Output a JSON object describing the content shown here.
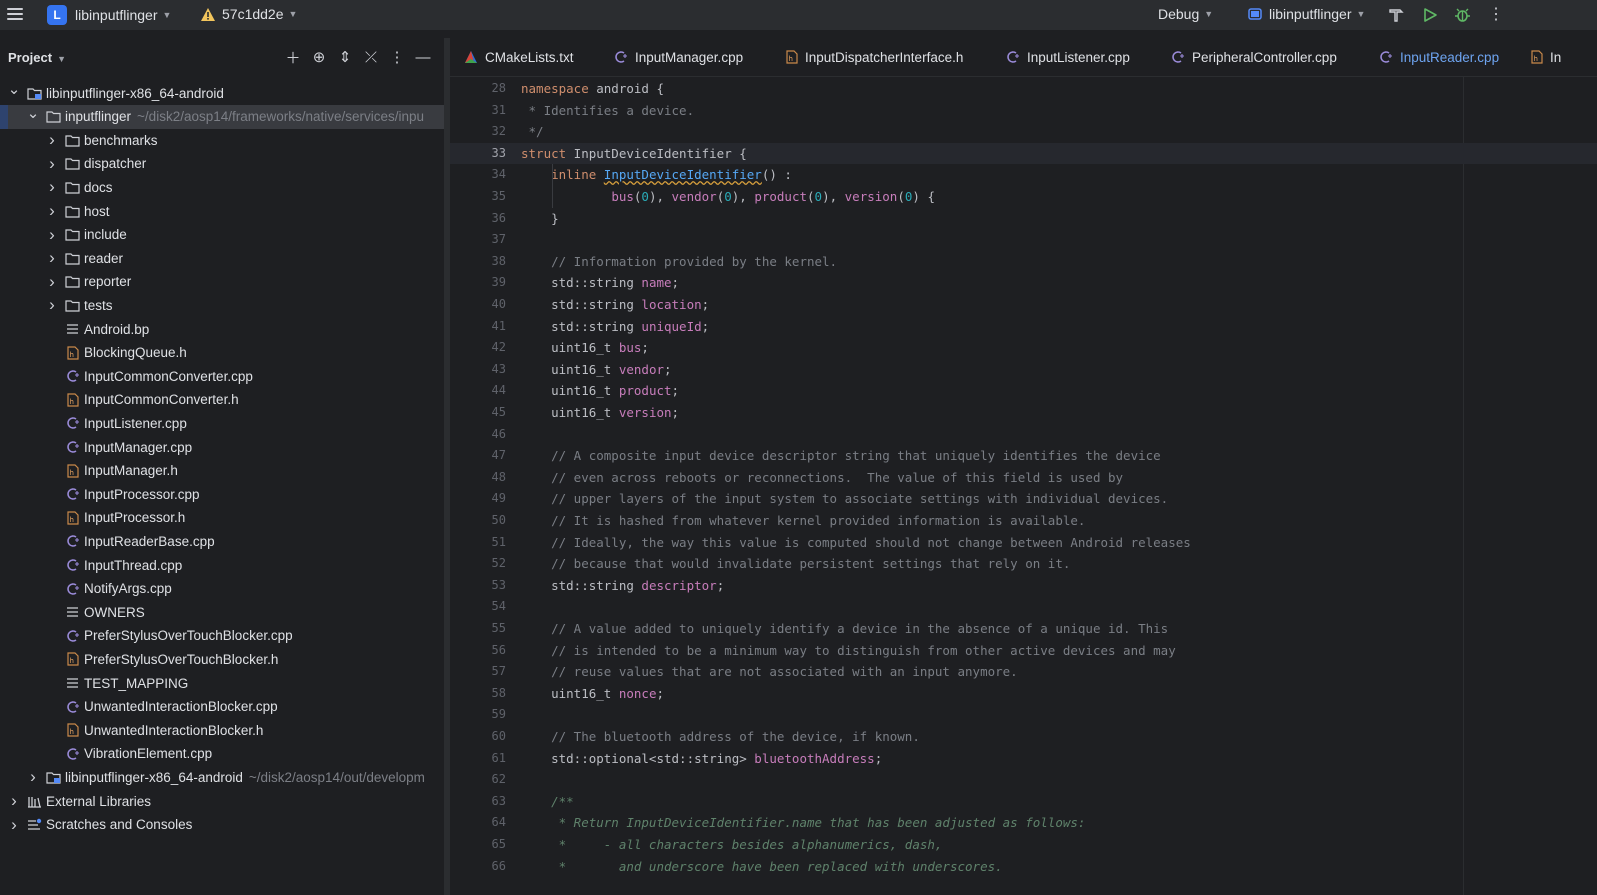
{
  "titlebar": {
    "project_initial": "L",
    "project_name": "libinputflinger",
    "vcs_branch": "57c1dd2e",
    "run_config": "Debug",
    "target": "libinputflinger",
    "icons": [
      "hamburger-menu-icon",
      "warning-icon",
      "build-hammer-icon",
      "run-icon",
      "debug-icon",
      "more-vertical-icon"
    ]
  },
  "project_pane": {
    "title": "Project",
    "rows": [
      {
        "label": "libinputflinger-x86_64-android",
        "path": "",
        "icon": "module-icon",
        "arrow": "down",
        "depth": 0
      },
      {
        "label": "inputflinger",
        "path": "~/disk2/aosp14/frameworks/native/services/inpu",
        "icon": "folder-icon",
        "arrow": "down",
        "depth": 1,
        "selected": true
      },
      {
        "label": "benchmarks",
        "path": "",
        "icon": "folder-icon",
        "arrow": "right",
        "depth": 2
      },
      {
        "label": "dispatcher",
        "path": "",
        "icon": "folder-icon",
        "arrow": "right",
        "depth": 2
      },
      {
        "label": "docs",
        "path": "",
        "icon": "folder-icon",
        "arrow": "right",
        "depth": 2
      },
      {
        "label": "host",
        "path": "",
        "icon": "folder-icon",
        "arrow": "right",
        "depth": 2
      },
      {
        "label": "include",
        "path": "",
        "icon": "folder-icon",
        "arrow": "right",
        "depth": 2
      },
      {
        "label": "reader",
        "path": "",
        "icon": "folder-icon",
        "arrow": "right",
        "depth": 2
      },
      {
        "label": "reporter",
        "path": "",
        "icon": "folder-icon",
        "arrow": "right",
        "depth": 2
      },
      {
        "label": "tests",
        "path": "",
        "icon": "folder-icon",
        "arrow": "right",
        "depth": 2
      },
      {
        "label": "Android.bp",
        "path": "",
        "icon": "text-file-icon",
        "arrow": "",
        "depth": 2
      },
      {
        "label": "BlockingQueue.h",
        "path": "",
        "icon": "header-file-icon",
        "arrow": "",
        "depth": 2
      },
      {
        "label": "InputCommonConverter.cpp",
        "path": "",
        "icon": "cpp-file-icon",
        "arrow": "",
        "depth": 2
      },
      {
        "label": "InputCommonConverter.h",
        "path": "",
        "icon": "header-file-icon",
        "arrow": "",
        "depth": 2
      },
      {
        "label": "InputListener.cpp",
        "path": "",
        "icon": "cpp-file-icon",
        "arrow": "",
        "depth": 2
      },
      {
        "label": "InputManager.cpp",
        "path": "",
        "icon": "cpp-file-icon",
        "arrow": "",
        "depth": 2
      },
      {
        "label": "InputManager.h",
        "path": "",
        "icon": "header-file-icon",
        "arrow": "",
        "depth": 2
      },
      {
        "label": "InputProcessor.cpp",
        "path": "",
        "icon": "cpp-file-icon",
        "arrow": "",
        "depth": 2
      },
      {
        "label": "InputProcessor.h",
        "path": "",
        "icon": "header-file-icon",
        "arrow": "",
        "depth": 2
      },
      {
        "label": "InputReaderBase.cpp",
        "path": "",
        "icon": "cpp-file-icon",
        "arrow": "",
        "depth": 2
      },
      {
        "label": "InputThread.cpp",
        "path": "",
        "icon": "cpp-file-icon",
        "arrow": "",
        "depth": 2
      },
      {
        "label": "NotifyArgs.cpp",
        "path": "",
        "icon": "cpp-file-icon",
        "arrow": "",
        "depth": 2
      },
      {
        "label": "OWNERS",
        "path": "",
        "icon": "text-file-icon",
        "arrow": "",
        "depth": 2
      },
      {
        "label": "PreferStylusOverTouchBlocker.cpp",
        "path": "",
        "icon": "cpp-file-icon",
        "arrow": "",
        "depth": 2
      },
      {
        "label": "PreferStylusOverTouchBlocker.h",
        "path": "",
        "icon": "header-file-icon",
        "arrow": "",
        "depth": 2
      },
      {
        "label": "TEST_MAPPING",
        "path": "",
        "icon": "text-file-icon",
        "arrow": "",
        "depth": 2
      },
      {
        "label": "UnwantedInteractionBlocker.cpp",
        "path": "",
        "icon": "cpp-file-icon",
        "arrow": "",
        "depth": 2
      },
      {
        "label": "UnwantedInteractionBlocker.h",
        "path": "",
        "icon": "header-file-icon",
        "arrow": "",
        "depth": 2
      },
      {
        "label": "VibrationElement.cpp",
        "path": "",
        "icon": "cpp-file-icon",
        "arrow": "",
        "depth": 2
      },
      {
        "label": "libinputflinger-x86_64-android",
        "path": "~/disk2/aosp14/out/developm",
        "icon": "module-icon",
        "arrow": "right",
        "depth": 1
      },
      {
        "label": "External Libraries",
        "path": "",
        "icon": "library-icon",
        "arrow": "right",
        "depth": 0
      },
      {
        "label": "Scratches and Consoles",
        "path": "",
        "icon": "scratches-icon",
        "arrow": "right",
        "depth": 0
      }
    ]
  },
  "tabs": [
    {
      "label": "CMakeLists.txt",
      "icon": "cmake-icon",
      "active": false
    },
    {
      "label": "InputManager.cpp",
      "icon": "cpp-file-icon",
      "active": false
    },
    {
      "label": "InputDispatcherInterface.h",
      "icon": "header-file-icon",
      "active": false
    },
    {
      "label": "InputListener.cpp",
      "icon": "cpp-file-icon",
      "active": false
    },
    {
      "label": "PeripheralController.cpp",
      "icon": "cpp-file-icon",
      "active": false
    },
    {
      "label": "InputReader.cpp",
      "icon": "cpp-file-icon",
      "active": true
    },
    {
      "label": "In",
      "icon": "header-file-icon",
      "active": false
    }
  ],
  "editor": {
    "current_line": "33",
    "lines": [
      {
        "n": "28",
        "tokens": [
          [
            "kw",
            "namespace"
          ],
          [
            "type",
            " android {"
          ]
        ]
      },
      {
        "n": "31",
        "tokens": [
          [
            "comment",
            " * Identifies a device."
          ]
        ]
      },
      {
        "n": "32",
        "tokens": [
          [
            "comment",
            " */"
          ]
        ]
      },
      {
        "n": "33",
        "tokens": [
          [
            "kw",
            "struct"
          ],
          [
            "type",
            " InputDeviceIdentifier {"
          ]
        ]
      },
      {
        "n": "34",
        "tokens": [
          [
            "kw",
            "    inline "
          ],
          [
            "ufn",
            "InputDeviceIdentifier"
          ],
          [
            "type",
            "() :"
          ]
        ]
      },
      {
        "n": "35",
        "tokens": [
          [
            "type",
            "            "
          ],
          [
            "field",
            "bus"
          ],
          [
            "type",
            "("
          ],
          [
            "num",
            "0"
          ],
          [
            "type",
            "), "
          ],
          [
            "field",
            "vendor"
          ],
          [
            "type",
            "("
          ],
          [
            "num",
            "0"
          ],
          [
            "type",
            "), "
          ],
          [
            "field",
            "product"
          ],
          [
            "type",
            "("
          ],
          [
            "num",
            "0"
          ],
          [
            "type",
            "), "
          ],
          [
            "field",
            "version"
          ],
          [
            "type",
            "("
          ],
          [
            "num",
            "0"
          ],
          [
            "type",
            ") {"
          ]
        ]
      },
      {
        "n": "36",
        "tokens": [
          [
            "type",
            "    }"
          ]
        ]
      },
      {
        "n": "37",
        "tokens": []
      },
      {
        "n": "38",
        "tokens": [
          [
            "comment",
            "    // Information provided by the kernel."
          ]
        ]
      },
      {
        "n": "39",
        "tokens": [
          [
            "type",
            "    std::string "
          ],
          [
            "field",
            "name"
          ],
          [
            "type",
            ";"
          ]
        ]
      },
      {
        "n": "40",
        "tokens": [
          [
            "type",
            "    std::string "
          ],
          [
            "field",
            "location"
          ],
          [
            "type",
            ";"
          ]
        ]
      },
      {
        "n": "41",
        "tokens": [
          [
            "type",
            "    std::string "
          ],
          [
            "field",
            "uniqueId"
          ],
          [
            "type",
            ";"
          ]
        ]
      },
      {
        "n": "42",
        "tokens": [
          [
            "type",
            "    uint16_t "
          ],
          [
            "field",
            "bus"
          ],
          [
            "type",
            ";"
          ]
        ]
      },
      {
        "n": "43",
        "tokens": [
          [
            "type",
            "    uint16_t "
          ],
          [
            "field",
            "vendor"
          ],
          [
            "type",
            ";"
          ]
        ]
      },
      {
        "n": "44",
        "tokens": [
          [
            "type",
            "    uint16_t "
          ],
          [
            "field",
            "product"
          ],
          [
            "type",
            ";"
          ]
        ]
      },
      {
        "n": "45",
        "tokens": [
          [
            "type",
            "    uint16_t "
          ],
          [
            "field",
            "version"
          ],
          [
            "type",
            ";"
          ]
        ]
      },
      {
        "n": "46",
        "tokens": []
      },
      {
        "n": "47",
        "tokens": [
          [
            "comment",
            "    // A composite input device descriptor string that uniquely identifies the device"
          ]
        ]
      },
      {
        "n": "48",
        "tokens": [
          [
            "comment",
            "    // even across reboots or reconnections.  The value of this field is used by"
          ]
        ]
      },
      {
        "n": "49",
        "tokens": [
          [
            "comment",
            "    // upper layers of the input system to associate settings with individual devices."
          ]
        ]
      },
      {
        "n": "50",
        "tokens": [
          [
            "comment",
            "    // It is hashed from whatever kernel provided information is available."
          ]
        ]
      },
      {
        "n": "51",
        "tokens": [
          [
            "comment",
            "    // Ideally, the way this value is computed should not change between Android releases"
          ]
        ]
      },
      {
        "n": "52",
        "tokens": [
          [
            "comment",
            "    // because that would invalidate persistent settings that rely on it."
          ]
        ]
      },
      {
        "n": "53",
        "tokens": [
          [
            "type",
            "    std::string "
          ],
          [
            "field",
            "descriptor"
          ],
          [
            "type",
            ";"
          ]
        ]
      },
      {
        "n": "54",
        "tokens": []
      },
      {
        "n": "55",
        "tokens": [
          [
            "comment",
            "    // A value added to uniquely identify a device in the absence of a unique id. This"
          ]
        ]
      },
      {
        "n": "56",
        "tokens": [
          [
            "comment",
            "    // is intended to be a minimum way to distinguish from other active devices and may"
          ]
        ]
      },
      {
        "n": "57",
        "tokens": [
          [
            "comment",
            "    // reuse values that are not associated with an input anymore."
          ]
        ]
      },
      {
        "n": "58",
        "tokens": [
          [
            "type",
            "    uint16_t "
          ],
          [
            "field",
            "nonce"
          ],
          [
            "type",
            ";"
          ]
        ]
      },
      {
        "n": "59",
        "tokens": []
      },
      {
        "n": "60",
        "tokens": [
          [
            "comment",
            "    // The bluetooth address of the device, if known."
          ]
        ]
      },
      {
        "n": "61",
        "tokens": [
          [
            "type",
            "    std::optional<std::string> "
          ],
          [
            "field",
            "bluetoothAddress"
          ],
          [
            "type",
            ";"
          ]
        ]
      },
      {
        "n": "62",
        "tokens": []
      },
      {
        "n": "63",
        "tokens": [
          [
            "doc",
            "    /**"
          ]
        ]
      },
      {
        "n": "64",
        "tokens": [
          [
            "doc",
            "     * Return InputDeviceIdentifier.name that has been adjusted as follows:"
          ]
        ]
      },
      {
        "n": "65",
        "tokens": [
          [
            "doc",
            "     *     - all characters besides alphanumerics, dash,"
          ]
        ]
      },
      {
        "n": "66",
        "tokens": [
          [
            "doc",
            "     *       and underscore have been replaced with underscores."
          ]
        ]
      }
    ]
  },
  "colors": {
    "accent": "#3574f0",
    "active_tab": "#6ea4f0",
    "run_green": "#5fb865",
    "debug_green": "#5fb865",
    "warning": "#f2c55c"
  }
}
